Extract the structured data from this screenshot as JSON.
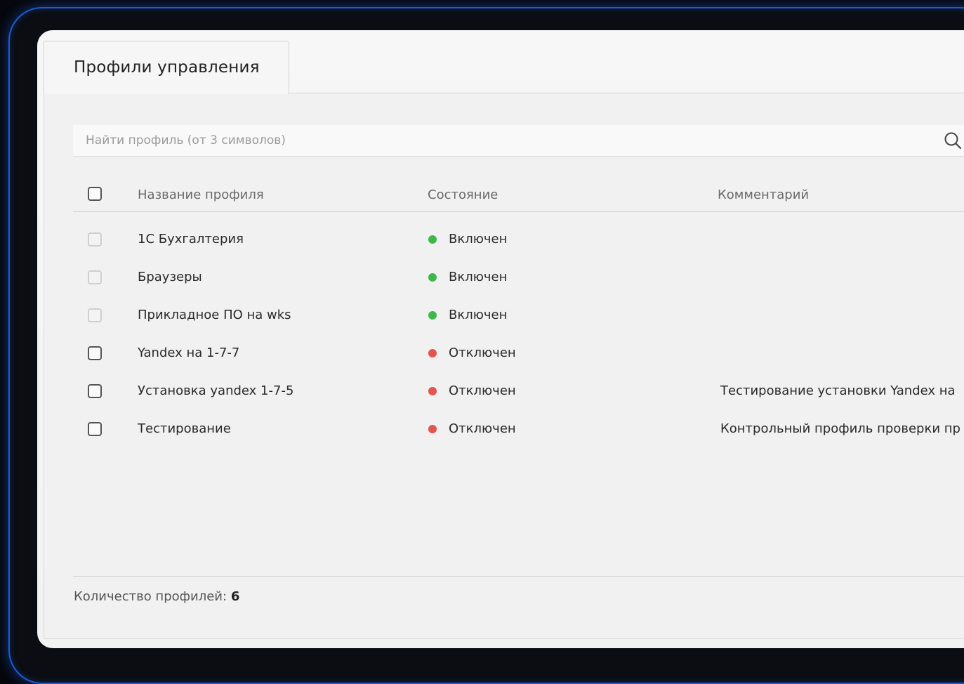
{
  "tab": {
    "label": "Профили управления"
  },
  "search": {
    "placeholder": "Найти профиль (от 3 символов)"
  },
  "table": {
    "columns": {
      "name": "Название профиля",
      "state": "Состояние",
      "comment": "Комментарий"
    },
    "rows": [
      {
        "name": "1С Бухгалтерия",
        "state": "Включен",
        "status": "on",
        "comment": "",
        "checkbox_enabled": false
      },
      {
        "name": "Браузеры",
        "state": "Включен",
        "status": "on",
        "comment": "",
        "checkbox_enabled": false
      },
      {
        "name": "Прикладное ПО на wks",
        "state": "Включен",
        "status": "on",
        "comment": "",
        "checkbox_enabled": false
      },
      {
        "name": "Yandex на 1-7-7",
        "state": "Отключен",
        "status": "off",
        "comment": "",
        "checkbox_enabled": true
      },
      {
        "name": "Установка yandex 1-7-5",
        "state": "Отключен",
        "status": "off",
        "comment": "Тестирование установки Yandex на",
        "checkbox_enabled": true
      },
      {
        "name": "Тестирование",
        "state": "Отключен",
        "status": "off",
        "comment": "Контрольный профиль проверки пр",
        "checkbox_enabled": true
      }
    ]
  },
  "footer": {
    "label": "Количество профилей:",
    "count": "6"
  },
  "colors": {
    "status_on": "#3fb84a",
    "status_off": "#e5544f",
    "frame_glow": "#1a5bd8"
  },
  "icons": {
    "search": "search-icon"
  }
}
